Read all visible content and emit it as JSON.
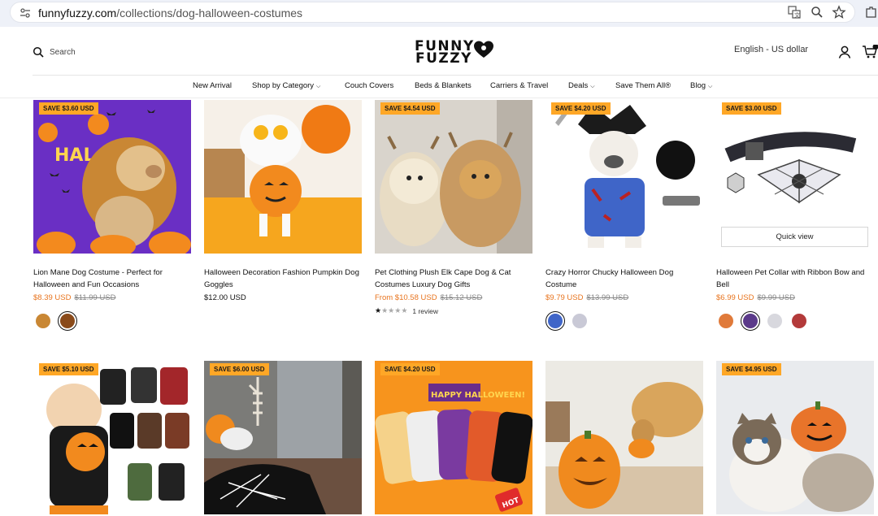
{
  "browser": {
    "url_host": "funnyfuzzy.com",
    "url_path": "/collections/dog-halloween-costumes"
  },
  "header": {
    "search_label": "Search",
    "logo_line1": "FUNNY",
    "logo_line2": "FUZZY",
    "locale": "English - US dollar"
  },
  "nav": [
    {
      "label": "New Arrival",
      "dropdown": false
    },
    {
      "label": "Shop by Category",
      "dropdown": true
    },
    {
      "label": "Couch Covers",
      "dropdown": false
    },
    {
      "label": "Beds & Blankets",
      "dropdown": false
    },
    {
      "label": "Carriers & Travel",
      "dropdown": false
    },
    {
      "label": "Deals",
      "dropdown": true
    },
    {
      "label": "Save Them All®",
      "dropdown": false
    },
    {
      "label": "Blog",
      "dropdown": true
    }
  ],
  "colors": {
    "badge": "#ffa726",
    "sale_price": "#e8741e"
  },
  "products": [
    {
      "badge": "SAVE $3.60 USD",
      "title": "Lion Mane Dog Costume - Perfect for Halloween and Fun Occasions",
      "price": "$8.39 USD",
      "compare": "$11.99 USD",
      "sale": true
    },
    {
      "badge": "",
      "title": "Halloween Decoration Fashion Pumpkin Dog Goggles",
      "price": "$12.00 USD",
      "compare": "",
      "sale": false
    },
    {
      "badge": "SAVE $4.54 USD",
      "title": "Pet Clothing Plush Elk Cape Dog & Cat Costumes Luxury Dog Gifts",
      "price": "From $10.58 USD",
      "compare": "$15.12 USD",
      "sale": true,
      "rating": 1,
      "reviews": "1 review"
    },
    {
      "badge": "SAVE $4.20 USD",
      "title": "Crazy Horror Chucky Halloween Dog Costume",
      "price": "$9.79 USD",
      "compare": "$13.99 USD",
      "sale": true
    },
    {
      "badge": "SAVE $3.00 USD",
      "title": "Halloween Pet Collar with Ribbon Bow and Bell",
      "price": "$6.99 USD",
      "compare": "$9.99 USD",
      "sale": true,
      "quick_view": "Quick view"
    },
    {
      "badge": "SAVE $5.10 USD"
    },
    {
      "badge": "SAVE $6.00 USD"
    },
    {
      "badge": "SAVE $4.20 USD",
      "banner": "HAPPY HALLOWEEN!",
      "tag": "HOT"
    },
    {
      "badge": ""
    },
    {
      "badge": "SAVE $4.95 USD"
    }
  ]
}
